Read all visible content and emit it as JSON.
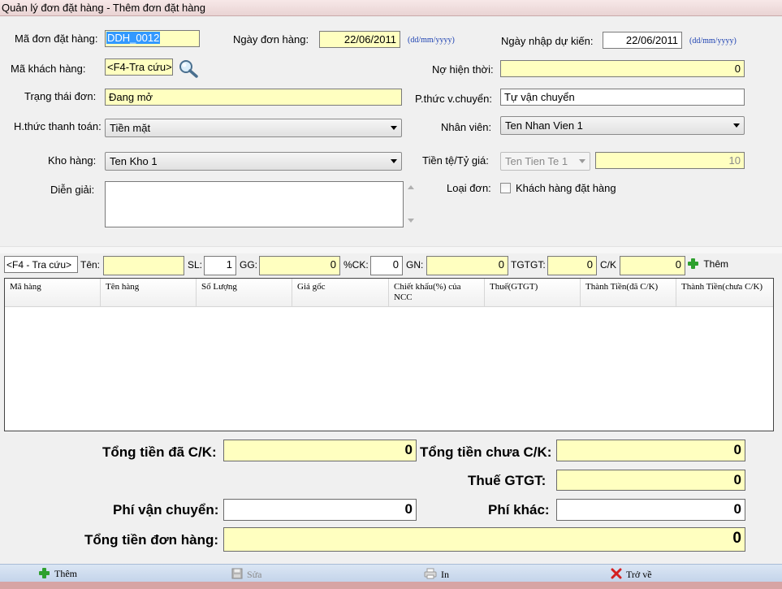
{
  "window": {
    "title": "Quản lý đơn đặt hàng - Thêm đơn đặt hàng"
  },
  "form": {
    "order_code_label": "Mã đơn đặt hàng:",
    "order_code_value": "DDH_0012",
    "order_date_label": "Ngày đơn hàng:",
    "order_date_value": "22/06/2011",
    "date_hint": "(dd/mm/yyyy)",
    "expected_date_label": "Ngày nhập dự kiến:",
    "expected_date_value": "22/06/2011",
    "customer_code_label": "Mã khách hàng:",
    "customer_code_value": "<F4-Tra cứu>",
    "current_debt_label": "Nợ hiện thời:",
    "current_debt_value": "0",
    "status_label": "Trạng thái đơn:",
    "status_value": "Đang mở",
    "shipping_method_label": "P.thức v.chuyển:",
    "shipping_method_value": "Tự vận chuyển",
    "payment_method_label": "H.thức thanh toán:",
    "payment_method_value": "Tiền mặt",
    "employee_label": "Nhân viên:",
    "employee_value": "Ten Nhan Vien 1",
    "warehouse_label": "Kho hàng:",
    "warehouse_value": "Ten Kho 1",
    "currency_label": "Tiền tệ/Tỷ giá:",
    "currency_value": "Ten Tien Te 1",
    "exchange_rate_value": "10",
    "description_label": "Diễn giải:",
    "description_value": "",
    "order_type_label": "Loại đơn:",
    "order_type_checkbox_label": "Khách hàng đặt hàng",
    "order_type_checked": false
  },
  "item_entry": {
    "lookup_value": "<F4 - Tra cứu>",
    "name_label": "Tên:",
    "name_value": "",
    "qty_label": "SL:",
    "qty_value": "1",
    "gg_label": "GG:",
    "gg_value": "0",
    "ck_label": "%CK:",
    "ck_value": "0",
    "gn_label": "GN:",
    "gn_value": "0",
    "tgtgt_label": "TGTGT:",
    "tgtgt_value": "0",
    "cashk_label": "C/K",
    "cashk_value": "0",
    "add_label": "Thêm"
  },
  "grid": {
    "columns": [
      "Mã hàng",
      "Tên hàng",
      "Số Lượng",
      "Giá gốc",
      "Chiết khấu(%) của NCC",
      "Thuế(GTGT)",
      "Thành Tiền(đã C/K)",
      "Thành Tiền(chưa C/K)"
    ],
    "rows": []
  },
  "summary": {
    "total_discounted_label": "Tổng tiền đã C/K:",
    "total_discounted_value": "0",
    "total_undiscounted_label": "Tổng tiền chưa C/K:",
    "total_undiscounted_value": "0",
    "vat_label": "Thuế GTGT:",
    "vat_value": "0",
    "shipping_fee_label": "Phí vận chuyển:",
    "shipping_fee_value": "0",
    "other_fee_label": "Phí khác:",
    "other_fee_value": "0",
    "order_total_label": "Tổng tiền đơn hàng:",
    "order_total_value": "0"
  },
  "toolbar": {
    "add_label": "Thêm",
    "edit_label": "Sửa",
    "print_label": "In",
    "back_label": "Trở về"
  },
  "colors": {
    "field_yellow": "#ffffc0",
    "selection_blue": "#3399ff",
    "toolbar_blue": "#c4d4ea",
    "hint_blue": "#1a3fb0",
    "plus_green": "#2ea02e",
    "close_red": "#d42020"
  },
  "icons": [
    "search-icon",
    "plus-icon",
    "save-icon",
    "printer-icon",
    "close-icon",
    "chevron-down-icon"
  ]
}
